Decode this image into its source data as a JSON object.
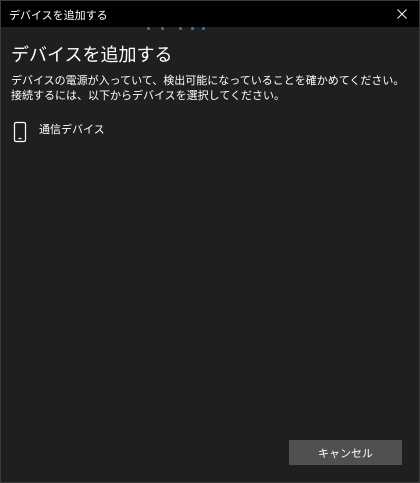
{
  "window": {
    "title": "デバイスを追加する",
    "close_icon": "close-icon"
  },
  "progress": {
    "accent": "#1a7fd4"
  },
  "main": {
    "heading": "デバイスを追加する",
    "description": "デバイスの電源が入っていて、検出可能になっていることを確かめてください。接続するには、以下からデバイスを選択してください。",
    "devices": [
      {
        "label": "通信デバイス",
        "icon": "phone-icon"
      }
    ]
  },
  "footer": {
    "cancel_label": "キャンセル"
  },
  "colors": {
    "background": "#1f1f1f",
    "titlebar": "#000000",
    "button": "#505050"
  }
}
